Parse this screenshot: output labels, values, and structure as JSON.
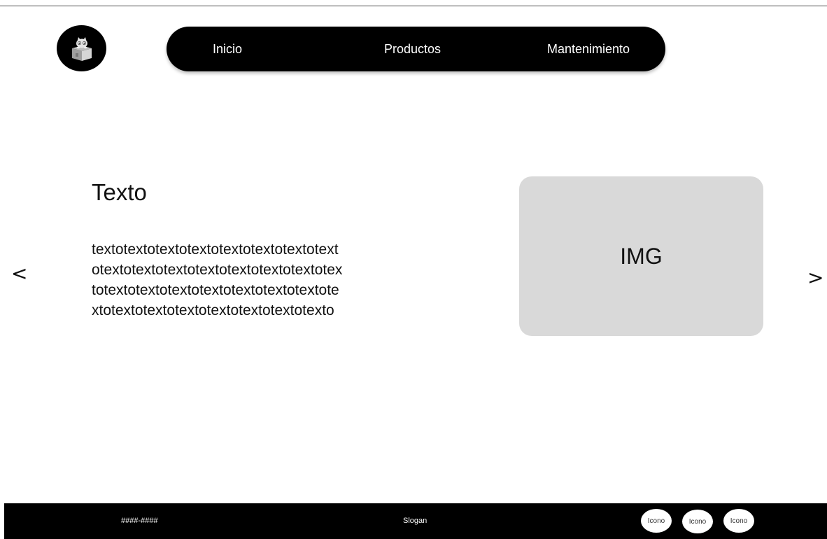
{
  "nav": {
    "items": [
      {
        "label": "Inicio"
      },
      {
        "label": "Productos"
      },
      {
        "label": "Mantenimiento"
      }
    ]
  },
  "carousel": {
    "prev_label": "<",
    "next_label": ">",
    "title": "Texto",
    "body_lines": [
      "textotextotextotextotextotextotextotext",
      "otextotextotextotextotextotextotextotex",
      "totextotextotextotextotextotextotextote",
      "xtotextotextotextotextotextotextotexto"
    ],
    "image_label": "IMG"
  },
  "footer": {
    "phone": "####-####",
    "slogan": "Slogan",
    "icons": [
      {
        "label": "Icono"
      },
      {
        "label": "Icono"
      },
      {
        "label": "Icono"
      }
    ]
  },
  "colors": {
    "primary": "#000000",
    "background": "#ffffff",
    "placeholder": "#d9d9d9"
  }
}
